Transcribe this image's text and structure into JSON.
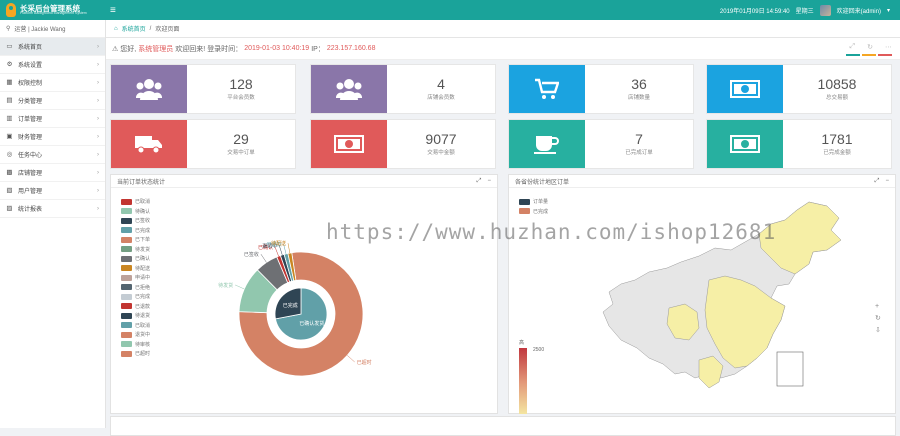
{
  "topbar": {
    "brand_title": "长采后台管理系统",
    "brand_subtitle": "Platform Background Management System",
    "datetime": "2019年01月09日 14:59:40",
    "weekday": "星期三",
    "user": "欢迎回来(admin)"
  },
  "sidebar": {
    "user": "运营 | Jackie Wang",
    "items": [
      {
        "icon": "home-icon",
        "glyph": "▭",
        "label": "系统首页",
        "active": true
      },
      {
        "icon": "gear-icon",
        "glyph": "⚙",
        "label": "系统设置"
      },
      {
        "icon": "user-icon",
        "glyph": "▦",
        "label": "权限控制"
      },
      {
        "icon": "list-icon",
        "glyph": "▤",
        "label": "分类管理"
      },
      {
        "icon": "order-icon",
        "glyph": "▥",
        "label": "订单管理"
      },
      {
        "icon": "finance-icon",
        "glyph": "▣",
        "label": "财务管理"
      },
      {
        "icon": "task-icon",
        "glyph": "◎",
        "label": "任务中心"
      },
      {
        "icon": "store-icon",
        "glyph": "▩",
        "label": "店铺管理"
      },
      {
        "icon": "member-icon",
        "glyph": "▧",
        "label": "用户管理"
      },
      {
        "icon": "stats-icon",
        "glyph": "▨",
        "label": "统计报表"
      }
    ]
  },
  "breadcrumb": {
    "home": "系统首页",
    "sep": "/",
    "current": "欢迎页面"
  },
  "welcome": {
    "prefix": "您好,",
    "role": "系统管理员",
    "greet": "欢迎回来!",
    "login_label": "登录时间：",
    "login_time": "2019-01-03 10:40:19",
    "ip_label": "IP：",
    "ip": "223.157.160.68"
  },
  "stats": [
    {
      "value": "128",
      "label": "平台会员数",
      "color": "#8a76a9",
      "icon": "users-icon"
    },
    {
      "value": "4",
      "label": "店铺会员数",
      "color": "#8a76a9",
      "icon": "users-icon"
    },
    {
      "value": "36",
      "label": "店铺数量",
      "color": "#1ba3e0",
      "icon": "cart-icon"
    },
    {
      "value": "10858",
      "label": "总交易额",
      "color": "#1ba3e0",
      "icon": "money-icon"
    },
    {
      "value": "29",
      "label": "交易中订单",
      "color": "#e05a5a",
      "icon": "truck-icon"
    },
    {
      "value": "9077",
      "label": "交易中金额",
      "color": "#e05a5a",
      "icon": "money-icon"
    },
    {
      "value": "7",
      "label": "已完成订单",
      "color": "#27b0a0",
      "icon": "cup-icon"
    },
    {
      "value": "1781",
      "label": "已完成金额",
      "color": "#27b0a0",
      "icon": "money-icon"
    }
  ],
  "pie_panel": {
    "title": "当前订单状态统计"
  },
  "map_panel": {
    "title": "各省份统计地区订单",
    "visual_max": "2500",
    "visual_min": "0",
    "visual_top": "高"
  },
  "watermark": "https://www.huzhan.com/ishop12681",
  "chart_data": [
    {
      "type": "pie",
      "title": "当前订单状态统计",
      "legend": [
        "已取消",
        "待确认",
        "已签收",
        "已完成",
        "已下单",
        "待发货",
        "已确认",
        "待配送",
        "申请中",
        "已拒绝",
        "已完成",
        "已退款",
        "待退货",
        "已取消",
        "退货中",
        "待审核",
        "已超时"
      ],
      "legend_colors": [
        "#c23531",
        "#91c7ae",
        "#2f4554",
        "#61a0a8",
        "#d48265",
        "#749f83",
        "#6e7074",
        "#ca8622",
        "#bda29a",
        "#546570",
        "#c4ccd3",
        "#c23531",
        "#2f4554",
        "#61a0a8",
        "#d48265",
        "#91c7ae",
        "#d48265"
      ],
      "inner": [
        {
          "label": "已确认发货",
          "value": 72,
          "color": "#61a0a8"
        },
        {
          "label": "已完成",
          "value": 28,
          "color": "#2f4554"
        }
      ],
      "outer": [
        {
          "label": "已超时",
          "value": 78,
          "color": "#d48265"
        },
        {
          "label": "待发货",
          "value": 12,
          "color": "#91c7ae"
        },
        {
          "label": "已签收",
          "value": 6,
          "color": "#6e7074"
        },
        {
          "label": "已确认",
          "value": 1,
          "color": "#c23531"
        },
        {
          "label": "退货中",
          "value": 1,
          "color": "#2f4554"
        },
        {
          "label": "已退款",
          "value": 1,
          "color": "#61a0a8"
        },
        {
          "label": "待配送",
          "value": 1,
          "color": "#ca8622"
        }
      ]
    },
    {
      "type": "map",
      "title": "各省份统计地区订单",
      "legend": [
        "订单量",
        "已完成"
      ],
      "legend_colors": [
        "#2f4554",
        "#d48265"
      ],
      "visual_range": [
        0,
        2500
      ]
    }
  ]
}
